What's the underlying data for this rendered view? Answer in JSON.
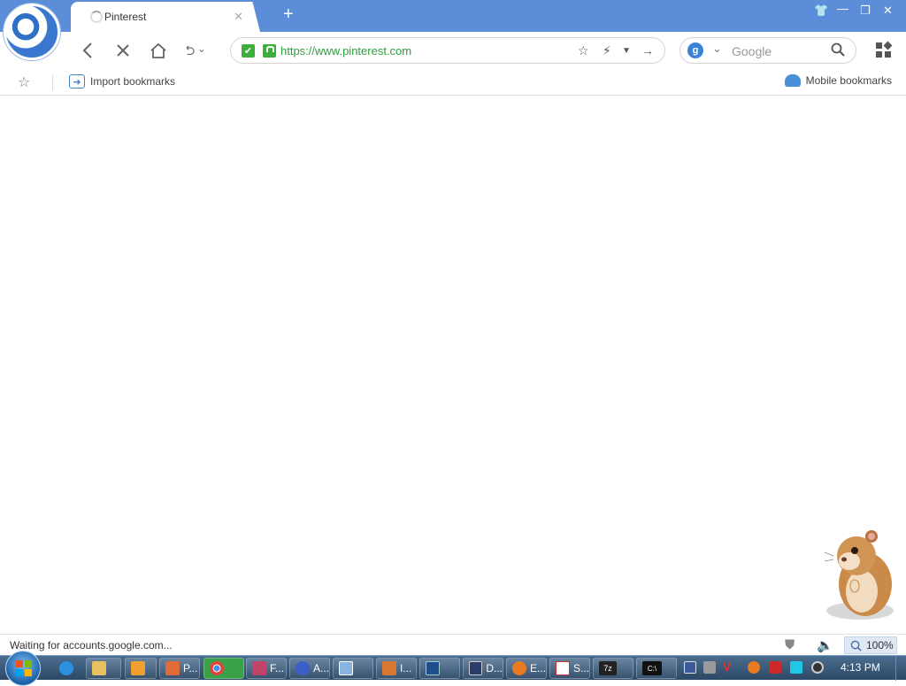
{
  "browser": {
    "tab": {
      "title": "Pinterest"
    },
    "address": {
      "url": "https://www.pinterest.com"
    },
    "search": {
      "engine_badge": "g",
      "placeholder": "Google"
    },
    "bookmarks": {
      "import_label": "Import bookmarks",
      "mobile_label": "Mobile bookmarks"
    },
    "status": {
      "text": "Waiting for accounts.google.com...",
      "zoom": "100%"
    },
    "colors": {
      "titlebar": "#5b8dd9",
      "secure": "#3cae3c",
      "url": "#2e9e3e"
    }
  },
  "taskbar": {
    "items": [
      {
        "label": "P...",
        "icon": "browser-app-icon"
      },
      {
        "label": "F...",
        "icon": "paint-icon"
      },
      {
        "label": "A...",
        "icon": "headphones-icon"
      },
      {
        "label": "I...",
        "icon": "brush-icon"
      },
      {
        "label": "D...",
        "icon": "floppy-icon"
      },
      {
        "label": "E...",
        "icon": "magnifier-icon"
      },
      {
        "label": "S...",
        "icon": "card-icon"
      }
    ],
    "pinned": [
      "ie-icon",
      "explorer-icon",
      "media-player-icon",
      "chrome-icon",
      "window-icon",
      "powershell-icon",
      "7zip-icon",
      "cmd-icon"
    ],
    "clock": "4:13 PM",
    "cmd_label": "C:\\",
    "sevenzip_label": "7z"
  }
}
